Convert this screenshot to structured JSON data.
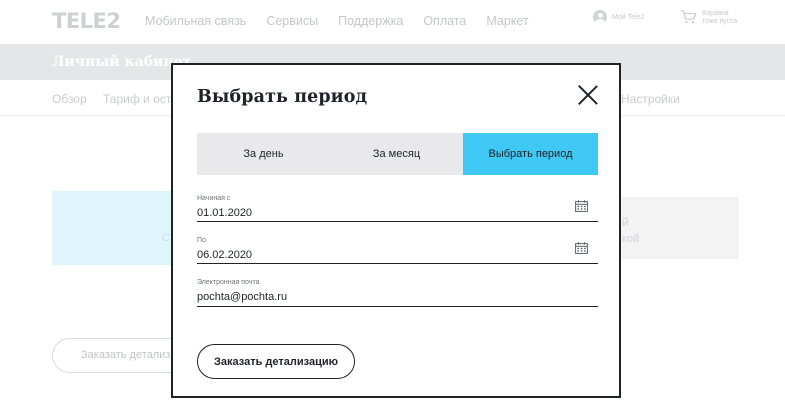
{
  "header": {
    "logo": "TELE2",
    "nav": [
      "Мобильная связь",
      "Сервисы",
      "Поддержка",
      "Оплата",
      "Маркет"
    ],
    "user_label": "Мой Tele2",
    "cart_label_1": "Корзина",
    "cart_label_2": "тоже пуста"
  },
  "cabinet": {
    "title": "Личный кабинет",
    "subnav": {
      "overview": "Обзор",
      "tariff": "Тариф и оста",
      "settings": "Настройки"
    }
  },
  "background": {
    "card_blue_text": "С",
    "card_gray_title": "й",
    "card_gray_text": "кой",
    "order_button": "Заказать детализаци"
  },
  "modal": {
    "title": "Выбрать период",
    "tabs": {
      "day": "За день",
      "month": "За месяц",
      "period": "Выбрать период"
    },
    "active_tab": "period",
    "accent_color": "#3fc8f3",
    "fields": {
      "start": {
        "label": "Начиная с",
        "value": "01.01.2020"
      },
      "end": {
        "label": "По",
        "value": "06.02.2020"
      },
      "email": {
        "label": "Электронная почта",
        "value": "pochta@pochta.ru"
      }
    },
    "order_button": "Заказать детализацию"
  }
}
